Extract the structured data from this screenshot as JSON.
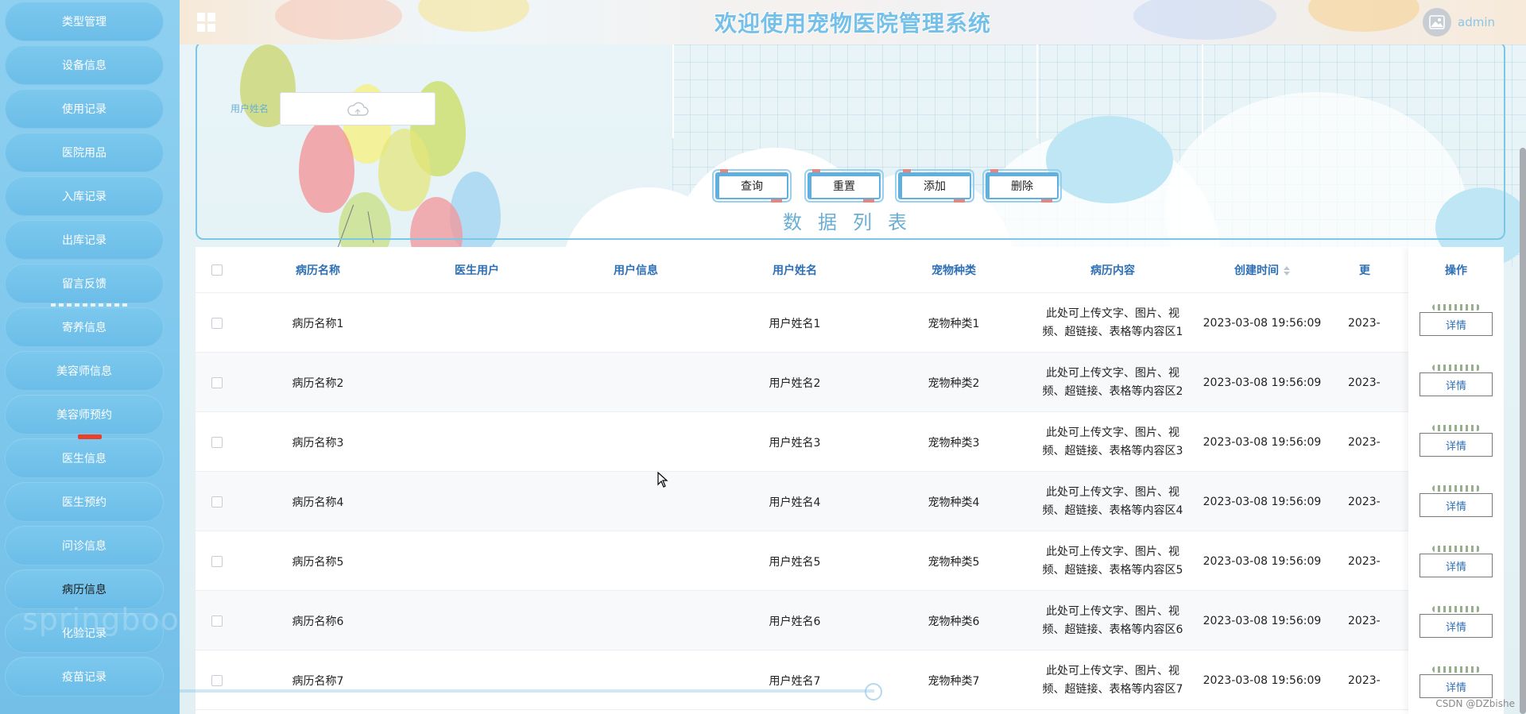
{
  "sidebar": {
    "items": [
      {
        "label": "类型管理",
        "active": false
      },
      {
        "label": "设备信息",
        "active": false
      },
      {
        "label": "使用记录",
        "active": false
      },
      {
        "label": "医院用品",
        "active": false
      },
      {
        "label": "入库记录",
        "active": false
      },
      {
        "label": "出库记录",
        "active": false
      },
      {
        "label": "留言反馈",
        "active": false
      },
      {
        "label": "寄养信息",
        "active": false
      },
      {
        "label": "美容师信息",
        "active": false
      },
      {
        "label": "美容师预约",
        "active": false
      },
      {
        "label": "医生信息",
        "active": false
      },
      {
        "label": "医生预约",
        "active": false
      },
      {
        "label": "问诊信息",
        "active": false
      },
      {
        "label": "病历信息",
        "active": true
      },
      {
        "label": "化验记录",
        "active": false
      },
      {
        "label": "疫苗记录",
        "active": false
      }
    ],
    "watermark": "springboot"
  },
  "header": {
    "title": "欢迎使用宠物医院管理系统",
    "username": "admin"
  },
  "search": {
    "label": "用户姓名",
    "value": "",
    "buttons": {
      "query": "查询",
      "reset": "重置",
      "add": "添加",
      "delete": "删除"
    }
  },
  "list_title": "数据列表",
  "table": {
    "columns": {
      "name": "病历名称",
      "doctor_user": "医生用户",
      "user_info": "用户信息",
      "user_name": "用户姓名",
      "pet_type": "宠物种类",
      "content": "病历内容",
      "created": "创建时间",
      "updated": "更",
      "action": "操作"
    },
    "detail_label": "详情",
    "rows": [
      {
        "name": "病历名称1",
        "doctor_user": "",
        "user_info": "",
        "user_name": "用户姓名1",
        "pet_type": "宠物种类1",
        "content": "此处可上传文字、图片、视频、超链接、表格等内容区1",
        "created": "2023-03-08 19:56:09",
        "updated": "2023-"
      },
      {
        "name": "病历名称2",
        "doctor_user": "",
        "user_info": "",
        "user_name": "用户姓名2",
        "pet_type": "宠物种类2",
        "content": "此处可上传文字、图片、视频、超链接、表格等内容区2",
        "created": "2023-03-08 19:56:09",
        "updated": "2023-"
      },
      {
        "name": "病历名称3",
        "doctor_user": "",
        "user_info": "",
        "user_name": "用户姓名3",
        "pet_type": "宠物种类3",
        "content": "此处可上传文字、图片、视频、超链接、表格等内容区3",
        "created": "2023-03-08 19:56:09",
        "updated": "2023-"
      },
      {
        "name": "病历名称4",
        "doctor_user": "",
        "user_info": "",
        "user_name": "用户姓名4",
        "pet_type": "宠物种类4",
        "content": "此处可上传文字、图片、视频、超链接、表格等内容区4",
        "created": "2023-03-08 19:56:09",
        "updated": "2023-"
      },
      {
        "name": "病历名称5",
        "doctor_user": "",
        "user_info": "",
        "user_name": "用户姓名5",
        "pet_type": "宠物种类5",
        "content": "此处可上传文字、图片、视频、超链接、表格等内容区5",
        "created": "2023-03-08 19:56:09",
        "updated": "2023-"
      },
      {
        "name": "病历名称6",
        "doctor_user": "",
        "user_info": "",
        "user_name": "用户姓名6",
        "pet_type": "宠物种类6",
        "content": "此处可上传文字、图片、视频、超链接、表格等内容区6",
        "created": "2023-03-08 19:56:09",
        "updated": "2023-"
      },
      {
        "name": "病历名称7",
        "doctor_user": "",
        "user_info": "",
        "user_name": "用户姓名7",
        "pet_type": "宠物种类7",
        "content": "此处可上传文字、图片、视频、超链接、表格等内容区7",
        "created": "2023-03-08 19:56:09",
        "updated": "2023-"
      }
    ]
  },
  "footer": {
    "watermark": "CSDN @DZbishe"
  },
  "icons": {
    "menu": "grid-icon",
    "avatar": "image-icon",
    "upload": "cloud-icon",
    "sort": "sort-caret-icon",
    "pointer": "mouse-cursor-icon"
  },
  "colors": {
    "sidebar": "#7cc6ec",
    "accent": "#6aaed4",
    "header_text": "#2d6fb5",
    "title": "#74c0e8"
  }
}
